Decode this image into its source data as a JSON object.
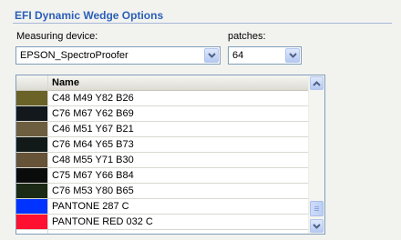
{
  "group": {
    "title": "EFI Dynamic Wedge Options"
  },
  "measuring_device": {
    "label": "Measuring device:",
    "value": "EPSON_SpectroProofer",
    "icon": "chevron-down-icon"
  },
  "patches": {
    "label": "patches:",
    "value": "64",
    "icon": "chevron-down-icon"
  },
  "table": {
    "column_header": "Name",
    "rows": [
      {
        "name": "C48 M49 Y82 B26",
        "swatch": "#6b6228"
      },
      {
        "name": "C76 M67 Y62 B69",
        "swatch": "#12181c"
      },
      {
        "name": "C46 M51 Y67 B21",
        "swatch": "#6e5e40"
      },
      {
        "name": "C76 M64 Y65 B73",
        "swatch": "#111a18"
      },
      {
        "name": "C48 M55 Y71 B30",
        "swatch": "#665338"
      },
      {
        "name": "C75 M67 Y66 B84",
        "swatch": "#0a0c0c"
      },
      {
        "name": "C76 M53 Y80 B65",
        "swatch": "#1a2a14"
      },
      {
        "name": "PANTONE 287 C",
        "swatch": "#0033ff"
      },
      {
        "name": "PANTONE RED 032 C",
        "swatch": "#ff1030"
      }
    ]
  }
}
